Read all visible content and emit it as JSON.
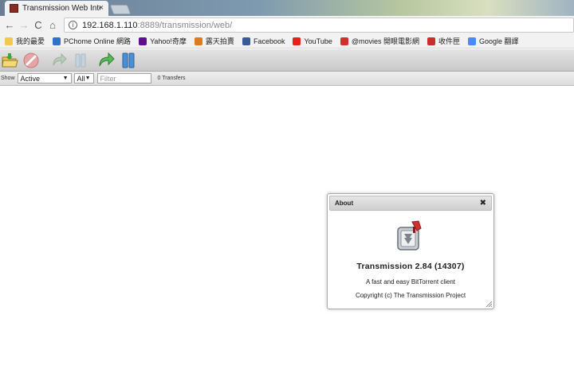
{
  "browser": {
    "tab_title": "Transmission Web Inter",
    "tab_close": "×",
    "nav": {
      "back": "←",
      "forward": "→",
      "reload": "C",
      "home": "⌂"
    },
    "url_host": "192.168.1.110",
    "url_rest": ":8889/transmission/web/",
    "info_glyph": "i"
  },
  "bookmarks": [
    {
      "label": "我的最愛",
      "icon": "folder-icon",
      "color": "#f2c94c"
    },
    {
      "label": "PChome Online 網路",
      "icon": "pchome-icon",
      "color": "#2e73c8"
    },
    {
      "label": "Yahoo!奇摩",
      "icon": "yahoo-icon",
      "color": "#5f0f8e"
    },
    {
      "label": "露天拍賣",
      "icon": "ruten-icon",
      "color": "#e07a1f"
    },
    {
      "label": "Facebook",
      "icon": "facebook-icon",
      "color": "#3b5998"
    },
    {
      "label": "YouTube",
      "icon": "youtube-icon",
      "color": "#e62117"
    },
    {
      "label": "@movies 開眼電影網",
      "icon": "atmovies-icon",
      "color": "#d0312d"
    },
    {
      "label": "收件匣",
      "icon": "gmail-icon",
      "color": "#c9302c"
    },
    {
      "label": "Google 翻譯",
      "icon": "google-translate-icon",
      "color": "#4a8af4"
    }
  ],
  "toolbar": {
    "buttons": [
      {
        "name": "open-torrent-button",
        "icon": "folder-open-icon"
      },
      {
        "name": "remove-torrent-button",
        "icon": "remove-icon"
      },
      {
        "name": "start-button",
        "icon": "play-icon"
      },
      {
        "name": "pause-button",
        "icon": "pause-icon"
      },
      {
        "name": "start-all-button",
        "icon": "play-all-icon"
      },
      {
        "name": "pause-all-button",
        "icon": "pause-all-icon"
      }
    ]
  },
  "filter": {
    "show_label": "Show",
    "state_value": "Active",
    "tracker_value": "All",
    "filter_placeholder": "Filter",
    "transfers_count": "0 Transfers"
  },
  "about": {
    "header": "About",
    "close_glyph": "✖",
    "app_title": "Transmission 2.84 (14307)",
    "tagline": "A fast and easy BitTorrent client",
    "copyright": "Copyright (c) The Transmission Project"
  }
}
